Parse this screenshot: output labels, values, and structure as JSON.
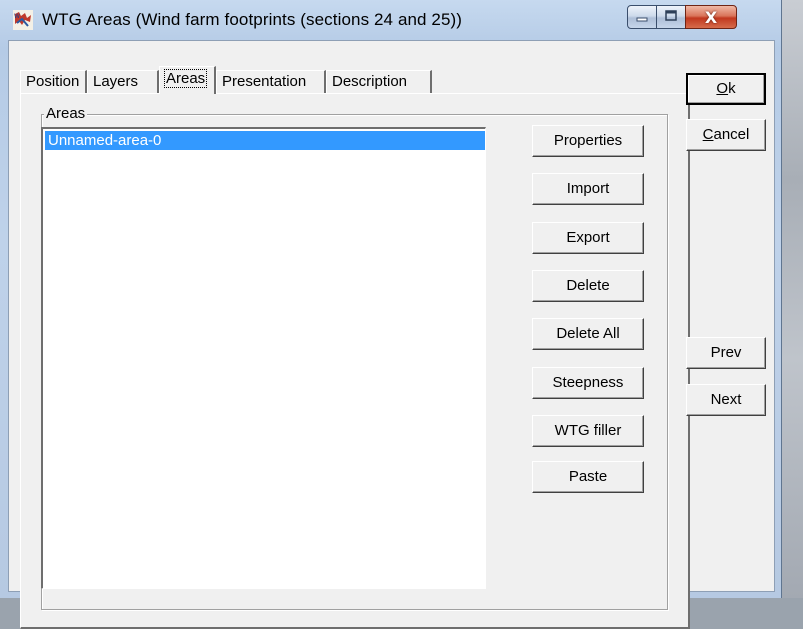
{
  "window": {
    "title": "WTG Areas  (Wind farm footprints (sections 24 and 25))",
    "icon": "windpro-app-icon"
  },
  "titlebar_buttons": {
    "minimize": "minimize-icon",
    "maximize": "maximize-icon",
    "close_label": "X"
  },
  "tabs": [
    {
      "label": "Position"
    },
    {
      "label": "Layers"
    },
    {
      "label": "Areas",
      "active": true
    },
    {
      "label": "Presentation"
    },
    {
      "label": "Description"
    }
  ],
  "areas_group": {
    "label": "Areas",
    "items": [
      "Unnamed-area-0"
    ],
    "selected_item": "Unnamed-area-0"
  },
  "side_buttons": {
    "properties": "Properties",
    "import": "Import",
    "export": "Export",
    "delete": "Delete",
    "delete_all": "Delete All",
    "steepness": "Steepness",
    "wtg_filler": "WTG filler",
    "paste": "Paste"
  },
  "dialog_buttons": {
    "ok_accel": "O",
    "ok_rest": "k",
    "cancel_accel": "C",
    "cancel_rest": "ancel",
    "prev": "Prev",
    "next": "Next"
  },
  "colors": {
    "selection": "#3399ff",
    "close_button": "#c1381f",
    "titlebar": "#bfd2ea"
  }
}
